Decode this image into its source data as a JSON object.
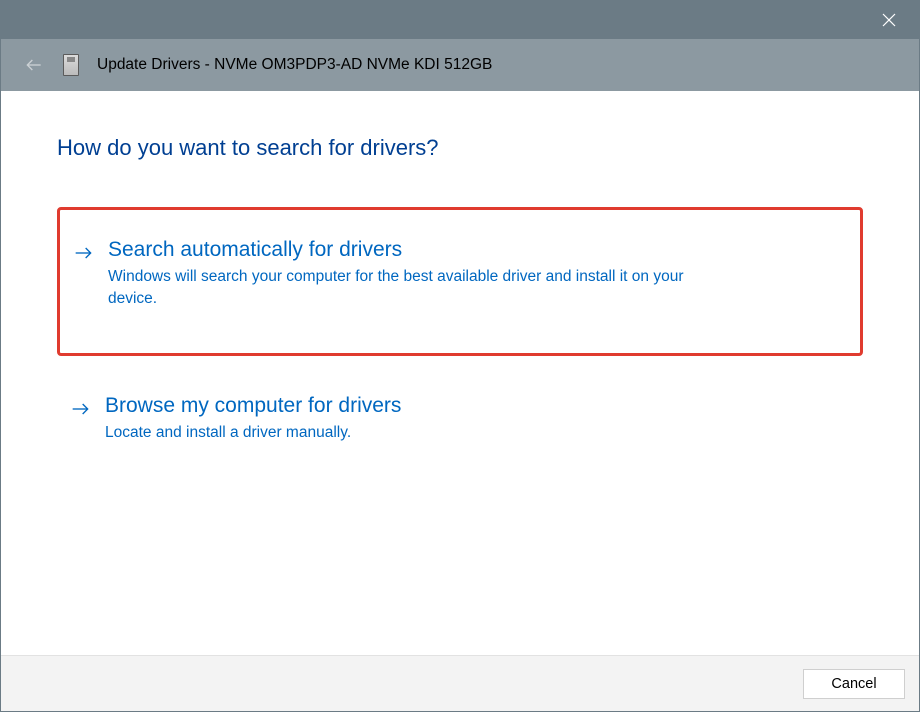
{
  "window": {
    "title": "Update Drivers - NVMe OM3PDP3-AD NVMe KDI 512GB"
  },
  "main": {
    "heading": "How do you want to search for drivers?",
    "options": [
      {
        "title": "Search automatically for drivers",
        "description": "Windows will search your computer for the best available driver and install it on your device."
      },
      {
        "title": "Browse my computer for drivers",
        "description": "Locate and install a driver manually."
      }
    ]
  },
  "footer": {
    "cancel_label": "Cancel"
  }
}
